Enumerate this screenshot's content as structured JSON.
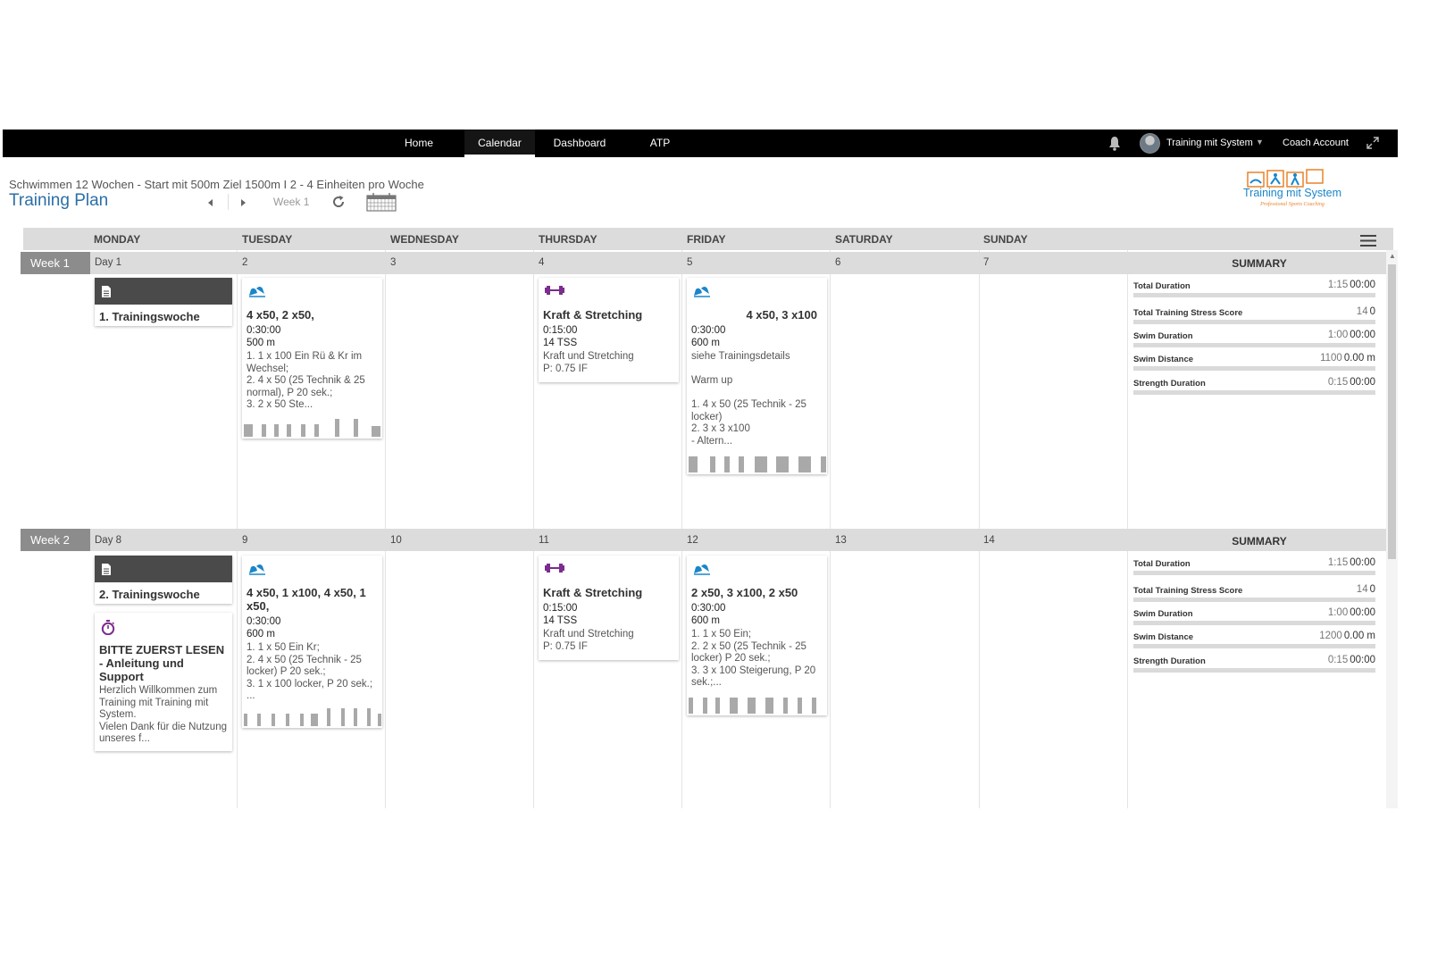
{
  "nav": {
    "items": [
      {
        "label": "Home"
      },
      {
        "label": "Calendar"
      },
      {
        "label": "Dashboard"
      },
      {
        "label": "ATP"
      }
    ],
    "user_name": "Training mit System",
    "coach_label": "Coach Account"
  },
  "header": {
    "subtitle": "Schwimmen 12 Wochen - Start mit 500m Ziel 1500m I 2 - 4 Einheiten pro Woche",
    "title": "Training Plan",
    "week_label": "Week 1"
  },
  "logo": {
    "text": "Training mit System",
    "tagline": "Professional Sports Coaching"
  },
  "days": [
    "MONDAY",
    "TUESDAY",
    "WEDNESDAY",
    "THURSDAY",
    "FRIDAY",
    "SATURDAY",
    "SUNDAY"
  ],
  "summary_title": "SUMMARY",
  "weeks": [
    {
      "label": "Week 1",
      "day_numbers": [
        "Day 1",
        "2",
        "3",
        "4",
        "5",
        "6",
        "7"
      ],
      "cards": {
        "monday_note": {
          "title": "1. Trainingswoche"
        },
        "tuesday": {
          "title": "4 x50, 2 x50,",
          "duration": "0:30:00",
          "distance": "500 m",
          "description": "1. 1 x 100 Ein Rü & Kr im Wechsel;\n2. 4 x 50 (25 Technik & 25 normal), P 20 sek.;\n3. 2 x 50 Ste..."
        },
        "thursday": {
          "title": "Kraft & Stretching",
          "duration": "0:15:00",
          "tss": "14 TSS",
          "description": "Kraft und Stretching\nP: 0.75 IF"
        },
        "friday": {
          "title": "4 x50, 3 x100",
          "duration": "0:30:00",
          "distance": "600 m",
          "description": "siehe Trainingsdetails\n\nWarm up\n\n1. 4 x 50 (25 Technik - 25 locker)\n2. 3 x  3 x100\n- Altern..."
        }
      },
      "summary": [
        {
          "label": "Total Duration",
          "planned": "1:15",
          "completed": "00:00"
        },
        {
          "label": "Total Training Stress Score",
          "planned": "14",
          "completed": "0"
        },
        {
          "label": "Swim Duration",
          "planned": "1:00",
          "completed": "00:00"
        },
        {
          "label": "Swim Distance",
          "planned": "1100",
          "completed": "0.00 m"
        },
        {
          "label": "Strength Duration",
          "planned": "0:15",
          "completed": "00:00"
        }
      ]
    },
    {
      "label": "Week 2",
      "day_numbers": [
        "Day 8",
        "9",
        "10",
        "11",
        "12",
        "13",
        "14"
      ],
      "cards": {
        "monday_note": {
          "title": "2. Trainingswoche"
        },
        "monday_info": {
          "title": "BITTE ZUERST LESEN - Anleitung und Support",
          "description": "Herzlich Willkommen zum Training mit Training mit System.\nVielen Dank für die Nutzung unseres f..."
        },
        "tuesday": {
          "title": "4 x50, 1 x100, 4 x50, 1 x50,",
          "duration": "0:30:00",
          "distance": "600 m",
          "description": "1. 1 x 50 Ein Kr;\n2. 4 x 50 (25 Technik - 25 locker) P 20 sek.;\n3. 1 x 100 locker, P 20 sek.;\n..."
        },
        "thursday": {
          "title": "Kraft & Stretching",
          "duration": "0:15:00",
          "tss": "14 TSS",
          "description": "Kraft und Stretching\nP: 0.75 IF"
        },
        "friday": {
          "title": "2 x50, 3 x100, 2 x50",
          "duration": "0:30:00",
          "distance": "600 m",
          "description": "1. 1 x 50 Ein;\n2. 2 x 50 (25 Technik - 25 locker) P 20 sek.;\n3. 3 x 100 Steigerung, P 20 sek.;..."
        }
      },
      "summary": [
        {
          "label": "Total Duration",
          "planned": "1:15",
          "completed": "00:00"
        },
        {
          "label": "Total Training Stress Score",
          "planned": "14",
          "completed": "0"
        },
        {
          "label": "Swim Duration",
          "planned": "1:00",
          "completed": "00:00"
        },
        {
          "label": "Swim Distance",
          "planned": "1200",
          "completed": "0.00 m"
        },
        {
          "label": "Strength Duration",
          "planned": "0:15",
          "completed": "00:00"
        }
      ]
    }
  ],
  "colors": {
    "swim_icon": "#1b86c9",
    "strength_icon": "#7b2d8e",
    "title_blue": "#2b6fa8",
    "note_header": "#4a4a4a",
    "week_tag": "#8c8c8c"
  }
}
